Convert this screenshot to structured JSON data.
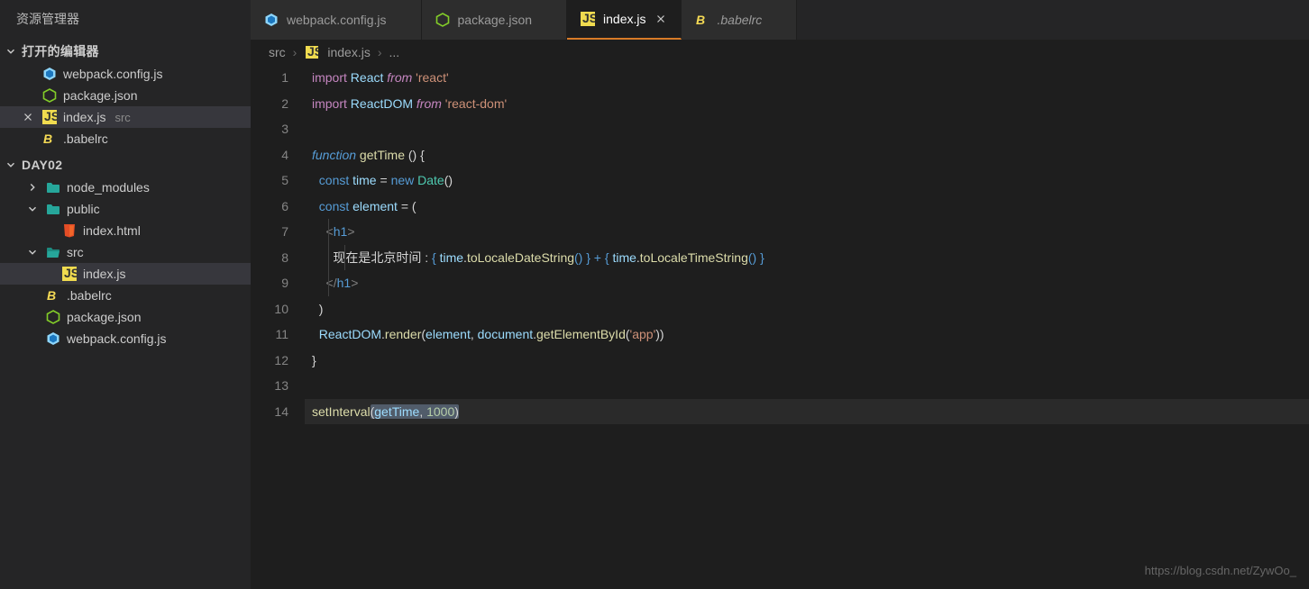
{
  "sidebar": {
    "title": "资源管理器",
    "open_editors_label": "打开的编辑器",
    "open_editors": [
      {
        "icon": "webpack",
        "name": "webpack.config.js"
      },
      {
        "icon": "nodejs",
        "name": "package.json"
      },
      {
        "icon": "js",
        "name": "index.js",
        "suffix": "src",
        "active": true,
        "closeable": true
      },
      {
        "icon": "babel",
        "name": ".babelrc"
      }
    ],
    "workspace_label": "DAY02",
    "tree": [
      {
        "kind": "folder",
        "depth": 0,
        "open": false,
        "icon": "folder-teal",
        "name": "node_modules"
      },
      {
        "kind": "folder",
        "depth": 0,
        "open": true,
        "icon": "folder-teal",
        "name": "public"
      },
      {
        "kind": "file",
        "depth": 1,
        "icon": "html5",
        "name": "index.html"
      },
      {
        "kind": "folder",
        "depth": 0,
        "open": true,
        "icon": "folder-teal-open",
        "name": "src"
      },
      {
        "kind": "file",
        "depth": 1,
        "icon": "js",
        "name": "index.js",
        "active": true
      },
      {
        "kind": "file",
        "depth": 0,
        "icon": "babel",
        "name": ".babelrc"
      },
      {
        "kind": "file",
        "depth": 0,
        "icon": "nodejs",
        "name": "package.json"
      },
      {
        "kind": "file",
        "depth": 0,
        "icon": "webpack",
        "name": "webpack.config.js"
      }
    ]
  },
  "tabs": [
    {
      "icon": "webpack",
      "name": "webpack.config.js"
    },
    {
      "icon": "nodejs",
      "name": "package.json"
    },
    {
      "icon": "js",
      "name": "index.js",
      "active": true,
      "close": true
    },
    {
      "icon": "babel",
      "name": ".babelrc",
      "italic": true
    }
  ],
  "breadcrumb": {
    "seg1": "src",
    "seg2": "index.js",
    "seg3": "..."
  },
  "gutter": [
    "1",
    "2",
    "3",
    "4",
    "5",
    "6",
    "7",
    "8",
    "9",
    "10",
    "11",
    "12",
    "13",
    "14"
  ],
  "code": {
    "l1a": "import",
    "l1b": " React ",
    "l1c": "from",
    "l1d": " 'react'",
    "l2a": "import",
    "l2b": " ReactDOM ",
    "l2c": "from",
    "l2d": " 'react-dom'",
    "l4a": "function",
    "l4b": " getTime ",
    "l4c": "() {",
    "l5a": "  const",
    "l5b": " time ",
    "l5c": "= ",
    "l5d": "new",
    "l5e": " Date",
    "l5f": "()",
    "l6a": "  const",
    "l6b": " element ",
    "l6c": "= (",
    "l7": "    <",
    "l7b": "h1",
    "l7c": ">",
    "l8a": "      现在是北京时间 : ",
    "l8b": "{ ",
    "l8c": "time",
    ".": ".",
    "l8d": "toLocaleDateString",
    "l8e": "() } + { ",
    "l8f": "time",
    "l8g": ".",
    "l8h": "toLocaleTimeString",
    "l8i": "() }",
    "l9": "    </",
    "l9b": "h1",
    "l9c": ">",
    "l10": "  )",
    "l11a": "  ReactDOM",
    "l11b": ".",
    "l11c": "render",
    "l11d": "(",
    "l11e": "element",
    "l11f": ", ",
    "l11g": "document",
    "l11h": ".",
    "l11i": "getElementById",
    "l11j": "(",
    "l11k": "'app'",
    "l11l": "))",
    "l12": "}",
    "l14a": "setInterval",
    "l14b": "(",
    "l14c": "getTime",
    "l14d": ", ",
    "l14e": "1000",
    "l14f": ")"
  },
  "watermark": "https://blog.csdn.net/ZywOo_"
}
